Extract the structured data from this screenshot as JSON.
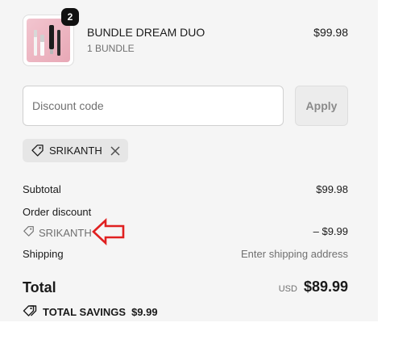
{
  "cart_item": {
    "quantity": "2",
    "name": "BUNDLE DREAM DUO",
    "variant": "1 BUNDLE",
    "price": "$99.98",
    "image_icon": "lip-gloss-product-image"
  },
  "discount": {
    "placeholder": "Discount code",
    "value": "",
    "apply_label": "Apply",
    "applied_code": "SRIKANTH"
  },
  "summary": {
    "subtotal_label": "Subtotal",
    "subtotal_value": "$99.98",
    "order_discount_label": "Order discount",
    "discount_code": "SRIKANTH",
    "discount_value": "– $9.99",
    "shipping_label": "Shipping",
    "shipping_value": "Enter shipping address",
    "total_label": "Total",
    "currency": "USD",
    "total_value": "$89.99",
    "savings_label": "TOTAL SAVINGS",
    "savings_value": "$9.99"
  },
  "colors": {
    "panel_background": "#f5f5f5",
    "annotation_arrow": "#e02020"
  }
}
